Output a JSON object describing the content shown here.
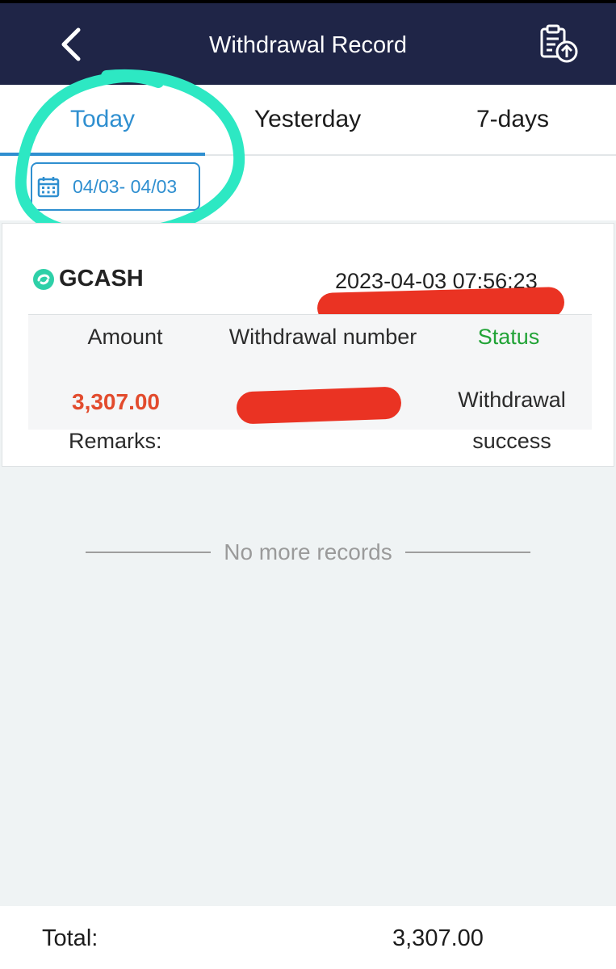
{
  "header": {
    "title": "Withdrawal Record",
    "back_icon": "chevron-left-icon",
    "action_icon": "clipboard-upload-icon"
  },
  "tabs": [
    {
      "label": "Today",
      "active": true
    },
    {
      "label": "Yesterday",
      "active": false
    },
    {
      "label": "7-days",
      "active": false
    }
  ],
  "date_range": {
    "label": "04/03- 04/03",
    "icon": "calendar-icon"
  },
  "record": {
    "method": "GCASH",
    "method_icon": "gcash-logo-icon",
    "timestamp": "2023-04-03 07:56:23",
    "columns": {
      "amount": "Amount",
      "number": "Withdrawal number",
      "status": "Status"
    },
    "amount": "3,307.00",
    "status_value": "Withdrawal success",
    "remarks_label": "Remarks:"
  },
  "list_end": {
    "text": "No more records"
  },
  "footer": {
    "total_label": "Total:",
    "total_value": "3,307.00"
  },
  "colors": {
    "header_bg": "#1f2547",
    "accent_blue": "#2f8fd0",
    "status_green": "#21a336",
    "amount_red": "#e24b2d",
    "highlight_teal": "#2de8c3",
    "redaction_red": "#ea3323"
  }
}
